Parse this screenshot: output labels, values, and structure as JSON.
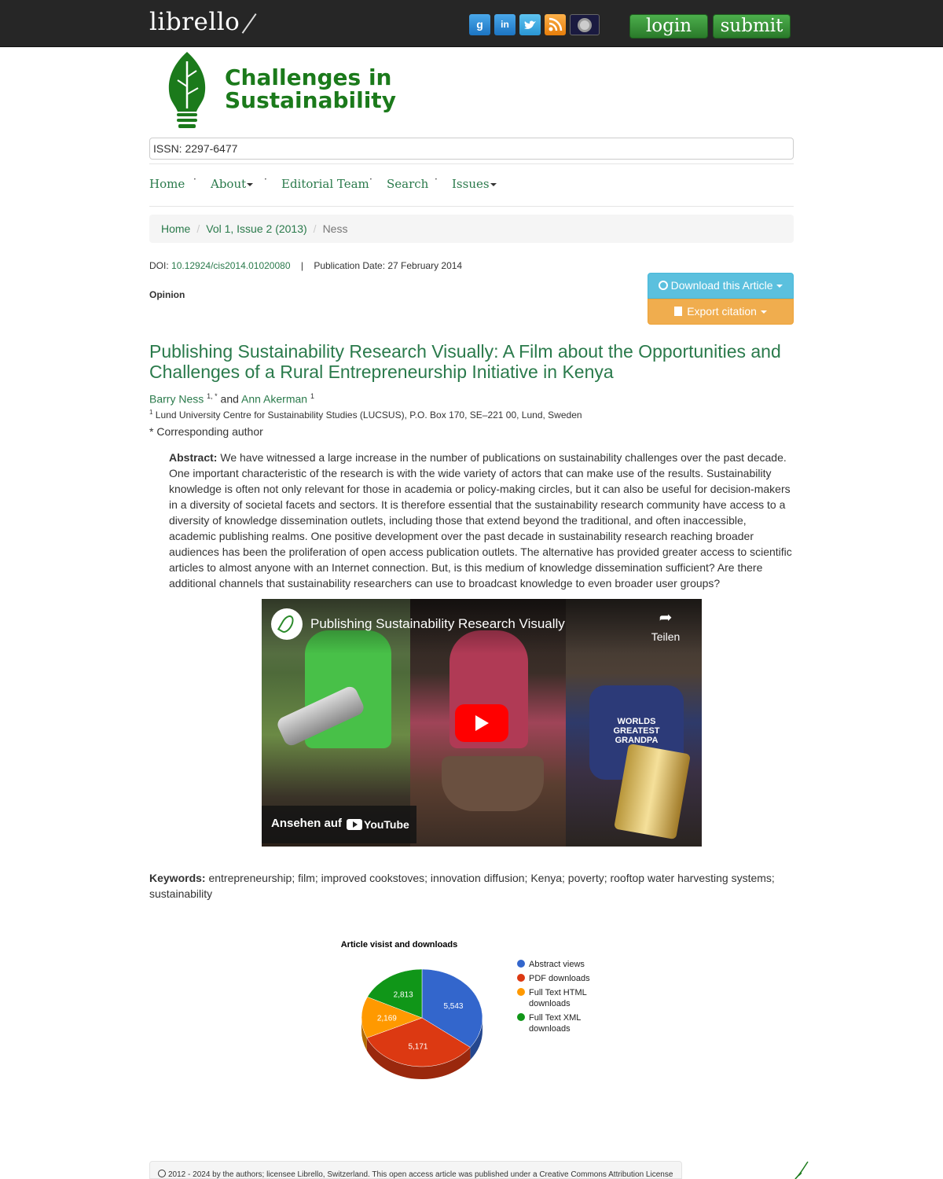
{
  "topbar": {
    "logo_text": "librello",
    "social": [
      "google-icon",
      "linkedin-icon",
      "twitter-icon",
      "rss-icon",
      "archive-icon"
    ],
    "login_label": "login",
    "submit_label": "submit"
  },
  "journal": {
    "name_line1": "Challenges in",
    "name_line2": "Sustainability",
    "issn": "ISSN: 2297-6477",
    "brand_color": "#1b7a1b"
  },
  "nav": {
    "home": "Home",
    "about": "About",
    "editorial": "Editorial Team",
    "search": "Search",
    "issues": "Issues"
  },
  "breadcrumb": {
    "home": "Home",
    "issue": "Vol 1, Issue 2 (2013)",
    "current": "Ness"
  },
  "article": {
    "doi_label": "DOI:",
    "doi": "10.12924/cis2014.01020080",
    "pub_date": "Publication Date: 27 February 2014",
    "type": "Opinion",
    "download_label": "Download this Article",
    "export_label": "Export citation",
    "title": "Publishing Sustainability Research Visually: A Film about the Opportunities and Challenges of a Rural Entrepreneurship Initiative in Kenya",
    "author1": "Barry Ness",
    "author1_sup": "1, *",
    "and": "and",
    "author2": "Ann Akerman",
    "author2_sup": "1",
    "affil_sup": "1",
    "affiliation": "Lund University Centre for Sustainability Studies (LUCSUS), P.O. Box 170, SE–221 00, Lund, Sweden",
    "corr_mark": "*",
    "corr_text": "Corresponding author",
    "abstract_label": "Abstract:",
    "abstract": "We have witnessed a large increase in the number of publications on sustainability challenges over the past decade. One important characteristic of the research is with the wide variety of actors that can make use of the results. Sustainability knowledge is often not only relevant for those in academia or policy-making circles, but it can also be useful for decision-makers in a diversity of societal facets and sectors. It is therefore essential that the sustainability research community have access to a diversity of knowledge dissemination outlets, including those that extend beyond the traditional, and often inaccessible, academic publishing realms. One positive development over the past decade in sustainability research reaching broader audiences has been the proliferation of open access publication outlets. The alternative has provided greater access to scientific articles to almost anyone with an Internet connection. But, is this medium of knowledge dissemination sufficient? Are there additional channels that sustainability researchers can use to broadcast knowledge to even broader user groups?",
    "keywords_label": "Keywords:",
    "keywords": "entrepreneurship; film; improved cookstoves; innovation diffusion; Kenya; poverty; rooftop water harvesting systems; sustainability"
  },
  "video": {
    "title": "Publishing Sustainability Research Visually",
    "share_label": "Teilen",
    "watch_label": "Ansehen auf",
    "youtube_label": "YouTube",
    "shirt_text": "WORLDS GREATEST GRANDPA"
  },
  "chart_data": {
    "type": "pie",
    "title": "Article visist and downloads",
    "categories": [
      "Abstract views",
      "PDF downloads",
      "Full Text HTML downloads",
      "Full Text XML downloads"
    ],
    "values": [
      5543,
      5171,
      2169,
      2813
    ],
    "value_labels": [
      "5,543",
      "5,171",
      "2,169",
      "2,813"
    ],
    "colors": [
      "#3366cc",
      "#dc3912",
      "#ff9900",
      "#109618"
    ],
    "legend_lines": [
      [
        "Abstract views"
      ],
      [
        "PDF downloads"
      ],
      [
        "Full Text HTML",
        "downloads"
      ],
      [
        "Full Text XML",
        "downloads"
      ]
    ],
    "legend_position": "right",
    "style": "3d"
  },
  "footer": {
    "text": "2012 - 2024 by the authors; licensee Librello, Switzerland. This open access article was published under a Creative Commons Attribution License"
  }
}
